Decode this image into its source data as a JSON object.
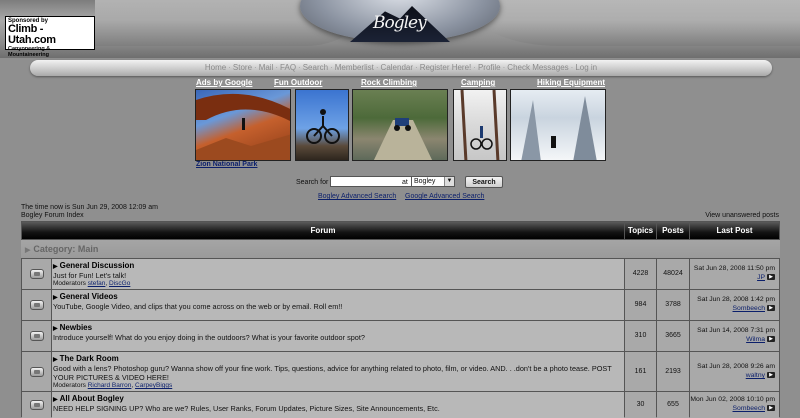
{
  "sponsor": {
    "prefix": "Sponsored by",
    "name": "Climb - Utah.com",
    "tagline": "Canyoneering & Mountaineering"
  },
  "site_logo": "Bogley",
  "nav": [
    "Home",
    "Store",
    "Mail",
    "FAQ",
    "Search",
    "Memberlist",
    "Calendar",
    "Register Here!",
    "Profile",
    "Check Messages",
    "Log in"
  ],
  "ads": {
    "ads_by": "Ads by Google",
    "links": [
      "Fun Outdoor",
      "Rock Climbing",
      "Camping",
      "Hiking Equipment"
    ],
    "caption": "Zion National Park"
  },
  "search": {
    "label": "Search for",
    "at": "at",
    "site_value": "Bogley",
    "button": "Search",
    "advanced_bogley": "Bogley Advanced Search",
    "advanced_google": "Google Advanced Search"
  },
  "forum": {
    "time_now": "The time now is Sun Jun 29, 2008 12:09 am",
    "index_link": "Bogley Forum Index",
    "unanswered": "View unanswered posts",
    "headers": {
      "forum": "Forum",
      "topics": "Topics",
      "posts": "Posts",
      "last_post": "Last Post"
    },
    "category": "Category: Main",
    "moderators_label": "Moderators",
    "forums": [
      {
        "title": "General Discussion",
        "desc": "Just for Fun! Let's talk!",
        "mods": [
          "stefan",
          "DiscGo"
        ],
        "topics": "4228",
        "posts": "48024",
        "last_date": "Sat Jun 28, 2008 11:50 pm",
        "last_user": "JP"
      },
      {
        "title": "General Videos",
        "desc": "YouTube, Google Video, and clips that you come across on the web or by email. Roll em!!",
        "mods": [],
        "topics": "984",
        "posts": "3788",
        "last_date": "Sat Jun 28, 2008 1:42 pm",
        "last_user": "Sombeech"
      },
      {
        "title": "Newbies",
        "desc": "Introduce yourself! What do you enjoy doing in the outdoors? What is your favorite outdoor spot?",
        "mods": [],
        "topics": "310",
        "posts": "3665",
        "last_date": "Sat Jun 14, 2008 7:31 pm",
        "last_user": "Wilma"
      },
      {
        "title": "The Dark Room",
        "desc": "Good with a lens? Photoshop guru? Wanna show off your fine work. Tips, questions, advice for anything related to photo, film, or video. AND. . .don't be a photo tease. POST YOUR PICTURES & VIDEO HERE!",
        "mods": [
          "Richard Barron",
          "CarpeyBiggs"
        ],
        "topics": "161",
        "posts": "2193",
        "last_date": "Sat Jun 28, 2008 9:26 am",
        "last_user": "waltny"
      },
      {
        "title": "All About Bogley",
        "desc": "NEED HELP SIGNING UP? Who are we? Rules, User Ranks, Forum Updates, Picture Sizes, Site Announcements, Etc.",
        "mods": [],
        "topics": "30",
        "posts": "655",
        "last_date": "Mon Jun 02, 2008 10:10 pm",
        "last_user": "Sombeech"
      }
    ]
  },
  "colors": {
    "page_bg": "#8f8f8f",
    "link": "#0b1f6b",
    "header_black": "#000000",
    "row_bg": "#a9a9a9",
    "info_bg": "#b8b8b8"
  }
}
